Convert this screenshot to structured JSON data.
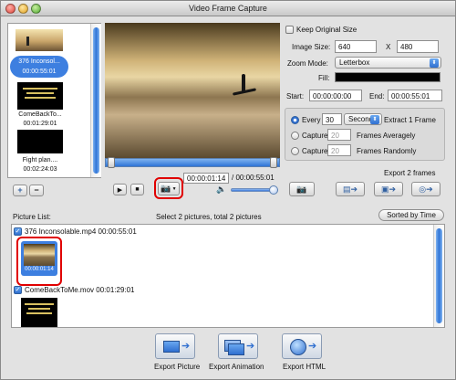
{
  "window": {
    "title": "Video Frame Capture"
  },
  "file_list": [
    {
      "name": "376 Inconsol...",
      "duration": "00:00:55:01",
      "selected": true
    },
    {
      "name": "ComeBackTo...",
      "duration": "00:01:29:01",
      "selected": false
    },
    {
      "name": "Fight plan....",
      "duration": "00:02:24:03",
      "selected": false
    }
  ],
  "settings": {
    "keep_original_size_label": "Keep Original Size",
    "image_size_label": "Image Size:",
    "width": "640",
    "x_label": "X",
    "height": "480",
    "zoom_mode_label": "Zoom Mode:",
    "zoom_mode_value": "Letterbox",
    "fill_label": "Fill:",
    "start_label": "Start:",
    "start_value": "00:00:00:00",
    "end_label": "End:",
    "end_value": "00:00:55:01"
  },
  "capture": {
    "every_label": "Every",
    "every_value": "30",
    "unit_value": "Second",
    "extract_label": "Extract 1 Frame",
    "capture_label_1": "Capture",
    "capture_value_1": "20",
    "averagely_label": "Frames Averagely",
    "capture_label_2": "Capture",
    "capture_value_2": "20",
    "randomly_label": "Frames Randomly"
  },
  "playback": {
    "current_time": "00:00:01:14",
    "total_time": "/ 00:00:55:01",
    "volume_level": 0.88
  },
  "export_count_label": "Export 2 frames",
  "picture_list": {
    "title": "Picture List:",
    "summary": "Select 2 pictures, total 2 pictures",
    "sort_button": "Sorted by Time",
    "groups": [
      {
        "name": "376 Inconsolable.mp4 00:00:55:01",
        "checked": true,
        "thumb_time": "00:00:01:14"
      },
      {
        "name": "ComeBackToMe.mov 00:01:29:01",
        "checked": true,
        "thumb_time": ""
      }
    ]
  },
  "export_buttons": {
    "picture": "Export Picture",
    "animation": "Export Animation",
    "html": "Export HTML"
  },
  "colors": {
    "selection_blue": "#3d7fe0",
    "highlight_red": "#e00000",
    "fill_color": "#000000"
  }
}
